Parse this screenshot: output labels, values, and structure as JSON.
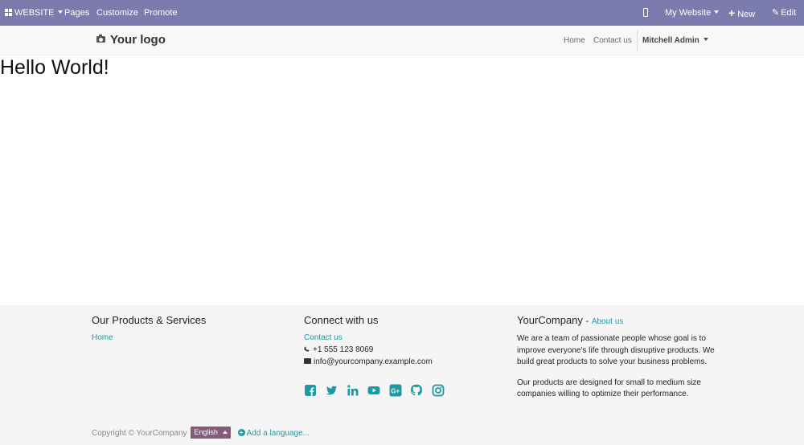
{
  "adminbar": {
    "website_label": "WEBSITE",
    "pages_label": "Pages",
    "customize_label": "Customize",
    "promote_label": "Promote",
    "my_website_label": "My Website",
    "new_label": "New",
    "edit_label": "Edit"
  },
  "header": {
    "logo_text": "Your logo",
    "nav_home": "Home",
    "nav_contact": "Contact us",
    "user_name": "Mitchell Admin"
  },
  "main": {
    "heading": "Hello World!"
  },
  "footer": {
    "products": {
      "title": "Our Products & Services",
      "link_home": "Home"
    },
    "connect": {
      "title": "Connect with us",
      "link_contact": "Contact us",
      "phone": "+1 555 123 8069",
      "email": "info@yourcompany.example.com",
      "social_icons": [
        "facebook-icon",
        "twitter-icon",
        "linkedin-icon",
        "youtube-icon",
        "google-plus-icon",
        "github-icon",
        "instagram-icon"
      ]
    },
    "about": {
      "company": "YourCompany",
      "separator": "-",
      "about_link": "About us",
      "paragraph1": "We are a team of passionate people whose goal is to improve everyone's life through disruptive products. We build great products to solve your business problems.",
      "paragraph2": "Our products are designed for small to medium size companies willing to optimize their performance."
    },
    "bottom": {
      "copyright": "Copyright © YourCompany",
      "language": "English",
      "add_language": "Add a language..."
    }
  },
  "colors": {
    "admin_bar": "#7c7bad",
    "link": "#1b9aa6",
    "language_button": "#875a7b"
  }
}
